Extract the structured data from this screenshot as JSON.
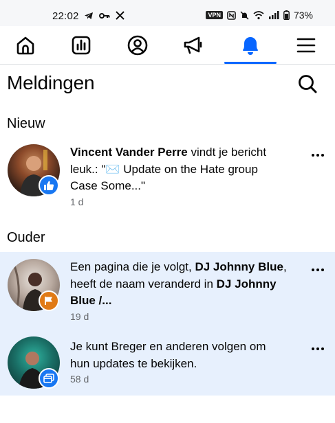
{
  "status_bar": {
    "time": "22:02",
    "vpn_label": "VPN",
    "battery_percent": "73%"
  },
  "nav": {
    "tabs": [
      {
        "name": "home",
        "icon": "home-icon",
        "active": false
      },
      {
        "name": "dashboard",
        "icon": "bar-chart-icon",
        "active": false
      },
      {
        "name": "profile",
        "icon": "profile-circle-icon",
        "active": false
      },
      {
        "name": "announcements",
        "icon": "megaphone-icon",
        "active": false
      },
      {
        "name": "notifications",
        "icon": "bell-icon",
        "active": true
      },
      {
        "name": "menu",
        "icon": "hamburger-icon",
        "active": false
      }
    ],
    "accent": "#0866ff"
  },
  "header": {
    "title": "Meldingen"
  },
  "sections": {
    "new_label": "Nieuw",
    "older_label": "Ouder"
  },
  "notifications": [
    {
      "actor": "Vincent Vander Perre",
      "text_after_actor": " vindt je bericht",
      "line2": "leuk.: \"✉️ Update on the Hate group",
      "line3": "Case Some...\"",
      "time": "1 d",
      "badge_icon": "like-icon",
      "badge_color": "#1877f2",
      "unread": false
    },
    {
      "line1_prefix": "Een pagina die je volgt, ",
      "line1_bold": "DJ Johnny Blue",
      "line1_suffix": ",",
      "line2_prefix": "heeft de naam veranderd in ",
      "line2_bold": "DJ Johnny",
      "line3_bold": "Blue /...",
      "time": "19 d",
      "badge_icon": "flag-icon",
      "badge_color": "#e07a16",
      "unread": true
    },
    {
      "line1_prefix": "Je kunt ",
      "line1_bold": "Breger",
      "line1_suffix": " en anderen volgen om",
      "line2": "hun updates te bekijken.",
      "time": "58 d",
      "badge_icon": "pages-icon",
      "badge_color": "#1877f2",
      "unread": true
    }
  ]
}
